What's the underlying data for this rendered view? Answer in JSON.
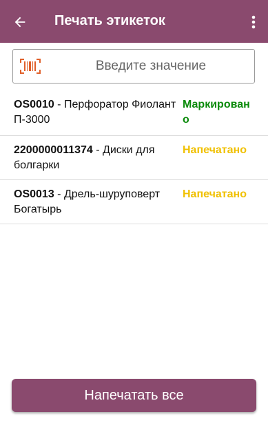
{
  "colors": {
    "primary": "#8a4a6e",
    "status_marked": "#0a8a0a",
    "status_printed": "#f0c000",
    "barcode_icon": "#e0602a"
  },
  "appbar": {
    "title": "Печать этикеток",
    "back_icon": "arrow-left-icon",
    "menu_icon": "more-vert-icon"
  },
  "search": {
    "placeholder": "Введите значение",
    "value": "",
    "icon": "barcode-icon"
  },
  "items": [
    {
      "code": "OS0010",
      "name": " - Перфоратор Фиолант П-3000",
      "status": "Маркирован о",
      "status_color": "#0a8a0a"
    },
    {
      "code": "2200000011374",
      "name": " - Диски для болгарки",
      "status": "Напечатано",
      "status_color": "#f0c000"
    },
    {
      "code": "OS0013",
      "name": " - Дрель-шуруповерт Богатырь",
      "status": "Напечатано",
      "status_color": "#f0c000"
    }
  ],
  "bottom": {
    "print_all_label": "Напечатать все"
  }
}
